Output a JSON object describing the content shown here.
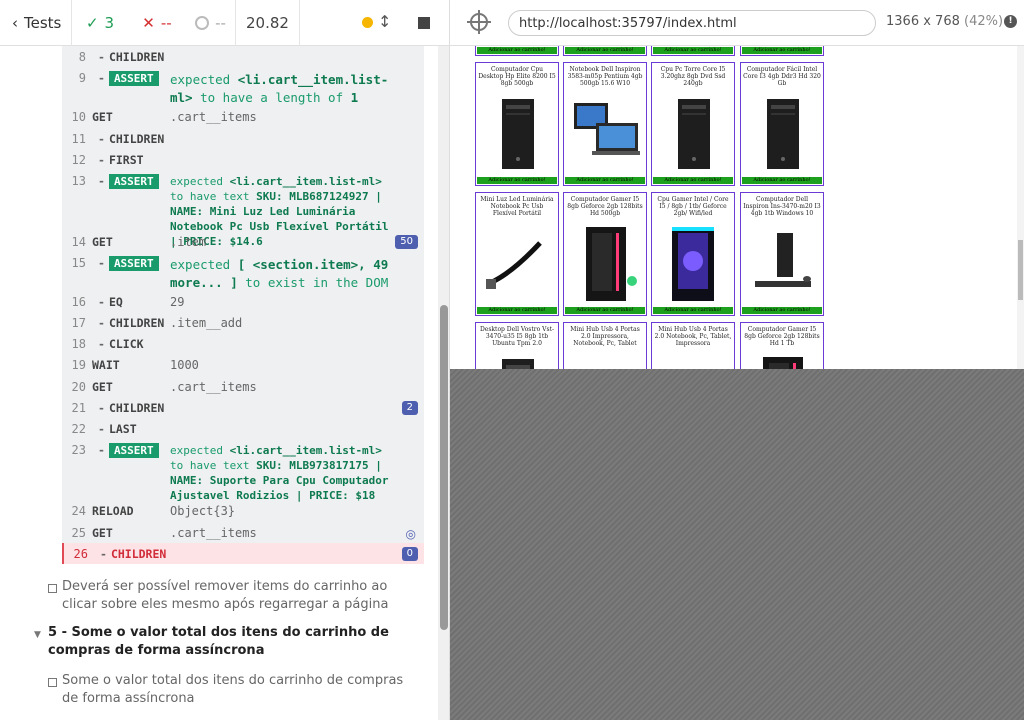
{
  "topbar": {
    "back_label": "Tests",
    "passed_count": "3",
    "failed_count": "--",
    "pending_count": "--",
    "duration": "20.82"
  },
  "commands": [
    {
      "num": "8",
      "name": "CHILDREN",
      "child": true,
      "msg": ""
    },
    {
      "num": "9",
      "name": "ASSERT",
      "child": true,
      "assert": true,
      "msg_parts": [
        "expected ",
        "<li.cart__item.list-ml>",
        " to have a length of ",
        "1"
      ]
    },
    {
      "num": "10",
      "name": "GET",
      "msg": ".cart__items"
    },
    {
      "num": "11",
      "name": "CHILDREN",
      "child": true,
      "msg": ""
    },
    {
      "num": "12",
      "name": "FIRST",
      "child": true,
      "msg": ""
    },
    {
      "num": "13",
      "name": "ASSERT",
      "child": true,
      "assert": true,
      "small": true,
      "msg_parts": [
        "expected ",
        "<li.cart__item.list-ml>",
        " to have text ",
        "SKU: MLB687124927 | NAME: Mini Luz Led Luminária Notebook Pc Usb Flexível Portátil | PRICE: $14.6"
      ]
    },
    {
      "num": "14",
      "name": "GET",
      "msg": ".item",
      "badge": "50"
    },
    {
      "num": "15",
      "name": "ASSERT",
      "child": true,
      "assert": true,
      "msg_parts": [
        "expected ",
        "[ <section.item>, 49 more... ]",
        " to exist in the DOM",
        ""
      ]
    },
    {
      "num": "16",
      "name": "EQ",
      "child": true,
      "msg": "29"
    },
    {
      "num": "17",
      "name": "CHILDREN",
      "child": true,
      "msg": ".item__add"
    },
    {
      "num": "18",
      "name": "CLICK",
      "child": true,
      "msg": ""
    },
    {
      "num": "19",
      "name": "WAIT",
      "msg": "1000"
    },
    {
      "num": "20",
      "name": "GET",
      "msg": ".cart__items"
    },
    {
      "num": "21",
      "name": "CHILDREN",
      "child": true,
      "msg": "",
      "badge": "2"
    },
    {
      "num": "22",
      "name": "LAST",
      "child": true,
      "msg": ""
    },
    {
      "num": "23",
      "name": "ASSERT",
      "child": true,
      "assert": true,
      "small": true,
      "msg_parts": [
        "expected ",
        "<li.cart__item.list-ml>",
        " to have text ",
        "SKU: MLB973817175 | NAME: Suporte Para Cpu Computador Ajustavel Rodizios | PRICE: $18"
      ]
    },
    {
      "num": "24",
      "name": "RELOAD",
      "msg": "Object{3}"
    },
    {
      "num": "25",
      "name": "GET",
      "msg": ".cart__items",
      "eye": true
    },
    {
      "num": "26",
      "name": "CHILDREN",
      "child": true,
      "msg": "",
      "badge": "0",
      "failed": true
    }
  ],
  "tests": {
    "test1": "Deverá ser possível remover items do carrinho ao clicar sobre eles mesmo após regarregar a página",
    "suite5": "5 - Some o valor total dos itens do carrinho de compras de forma assíncrona",
    "test2": "Some o valor total dos itens do carrinho de compras de forma assíncrona"
  },
  "aut": {
    "url": "http://localhost:35797/index.html",
    "viewport": "1366 x 768",
    "zoom": "(42%)",
    "add_button_label": "Adicionar ao carrinho!",
    "products": [
      {
        "title": "Computador Cpu Desktop Hp Elite 8200 I5 8gb 500gb",
        "icon": "tower-pc"
      },
      {
        "title": "Notebook Dell Inspiron 3583-m05p Pentium 4gb 500gb 15.6 W10",
        "icon": "laptop"
      },
      {
        "title": "Cpu Pc Torre Core I5 3.20ghz 8gb Dvd Ssd 240gb",
        "icon": "tower-pc"
      },
      {
        "title": "Computador Fácil Intel Core I3 4gb Ddr3 Hd 320 Gb",
        "icon": "tower-pc"
      },
      {
        "title": "Mini Luz Led Luminária Notebook Pc Usb Flexível Portátil",
        "icon": "usb-light"
      },
      {
        "title": "Computador Gamer I5 8gb Geforce 2gb 128bits Hd 500gb",
        "icon": "gamer-pc"
      },
      {
        "title": "Cpu Gamer Intel / Core I5 / 8gb / 1tb/ Geforce 2gb/ Wifi/led",
        "icon": "gamer-pc-blue"
      },
      {
        "title": "Computador Dell Inspiron Ins-3470-m20 I3 4gb 1tb Windows 10",
        "icon": "desktop-set"
      },
      {
        "title": "Desktop Dell Vostro Vst-3470-u35 I5 8gb 1tb Ubuntu Tpm 2.0",
        "icon": "tower-pc"
      },
      {
        "title": "Mini Hub Usb 4 Portas 2.0 Impressora, Notebook, Pc, Tablet",
        "icon": "usb-hub"
      },
      {
        "title": "Mini Hub Usb 4 Portas 2.0 Notebook, Pc, Tablet, Impressora",
        "icon": "usb-hub"
      },
      {
        "title": "Computador Gamer I5 8gb Geforce 2gb 128bits Hd 1 Tb",
        "icon": "gamer-pc"
      }
    ]
  }
}
